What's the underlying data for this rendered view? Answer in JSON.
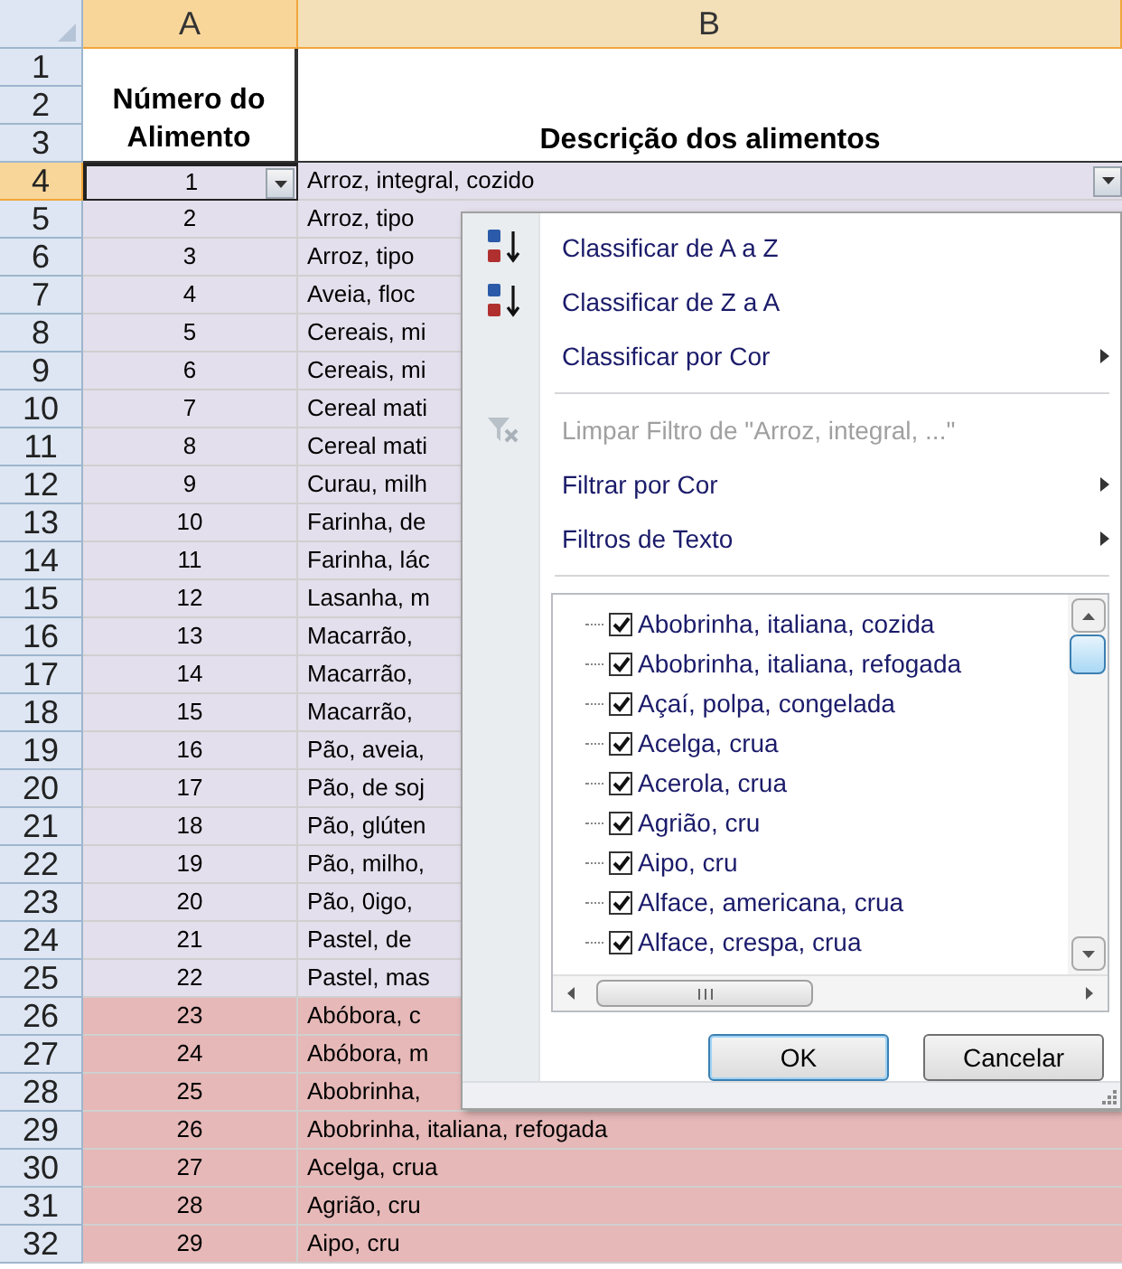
{
  "columns": [
    {
      "label": "A",
      "selected": true
    },
    {
      "label": "B",
      "selected": false
    }
  ],
  "row_numbers": [
    {
      "label": "1",
      "selected": false
    },
    {
      "label": "2",
      "selected": false
    },
    {
      "label": "3",
      "selected": false
    },
    {
      "label": "4",
      "selected": true
    },
    {
      "label": "5",
      "selected": false
    },
    {
      "label": "6",
      "selected": false
    },
    {
      "label": "7",
      "selected": false
    },
    {
      "label": "8",
      "selected": false
    },
    {
      "label": "9",
      "selected": false
    },
    {
      "label": "10",
      "selected": false
    },
    {
      "label": "11",
      "selected": false
    },
    {
      "label": "12",
      "selected": false
    },
    {
      "label": "13",
      "selected": false
    },
    {
      "label": "14",
      "selected": false
    },
    {
      "label": "15",
      "selected": false
    },
    {
      "label": "16",
      "selected": false
    },
    {
      "label": "17",
      "selected": false
    },
    {
      "label": "18",
      "selected": false
    },
    {
      "label": "19",
      "selected": false
    },
    {
      "label": "20",
      "selected": false
    },
    {
      "label": "21",
      "selected": false
    },
    {
      "label": "22",
      "selected": false
    },
    {
      "label": "23",
      "selected": false
    },
    {
      "label": "24",
      "selected": false
    },
    {
      "label": "25",
      "selected": false
    },
    {
      "label": "26",
      "selected": false
    },
    {
      "label": "27",
      "selected": false
    },
    {
      "label": "28",
      "selected": false
    },
    {
      "label": "29",
      "selected": false
    },
    {
      "label": "30",
      "selected": false
    },
    {
      "label": "31",
      "selected": false
    },
    {
      "label": "32",
      "selected": false
    }
  ],
  "header": {
    "number_title": [
      "Número do",
      "Alimento"
    ],
    "description_title": "Descrição dos alimentos"
  },
  "rows": [
    {
      "number": "1",
      "description": "Arroz, integral, cozido",
      "color": "#e4dfec",
      "filter_button": true
    },
    {
      "number": "2",
      "description": "Arroz, tipo",
      "color": "#e4dfec",
      "filter_button": false
    },
    {
      "number": "3",
      "description": "Arroz, tipo",
      "color": "#e4dfec",
      "filter_button": false
    },
    {
      "number": "4",
      "description": "Aveia, floc",
      "color": "#e4dfec",
      "filter_button": false
    },
    {
      "number": "5",
      "description": "Cereais, mi",
      "color": "#e4dfec",
      "filter_button": false
    },
    {
      "number": "6",
      "description": "Cereais, mi",
      "color": "#e4dfec",
      "filter_button": false
    },
    {
      "number": "7",
      "description": "Cereal mati",
      "color": "#e4dfec",
      "filter_button": false
    },
    {
      "number": "8",
      "description": "Cereal mati",
      "color": "#e4dfec",
      "filter_button": false
    },
    {
      "number": "9",
      "description": "Curau, milh",
      "color": "#e4dfec",
      "filter_button": false
    },
    {
      "number": "10",
      "description": "Farinha, de",
      "color": "#e4dfec",
      "filter_button": false
    },
    {
      "number": "11",
      "description": "Farinha, lác",
      "color": "#e4dfec",
      "filter_button": false
    },
    {
      "number": "12",
      "description": "Lasanha, m",
      "color": "#e4dfec",
      "filter_button": false
    },
    {
      "number": "13",
      "description": "Macarrão,",
      "color": "#e4dfec",
      "filter_button": false
    },
    {
      "number": "14",
      "description": "Macarrão,",
      "color": "#e4dfec",
      "filter_button": false
    },
    {
      "number": "15",
      "description": "Macarrão,",
      "color": "#e4dfec",
      "filter_button": false
    },
    {
      "number": "16",
      "description": "Pão, aveia,",
      "color": "#e4dfec",
      "filter_button": false
    },
    {
      "number": "17",
      "description": "Pão, de soj",
      "color": "#e4dfec",
      "filter_button": false
    },
    {
      "number": "18",
      "description": "Pão, glúten",
      "color": "#e4dfec",
      "filter_button": false
    },
    {
      "number": "19",
      "description": "Pão, milho,",
      "color": "#e4dfec",
      "filter_button": false
    },
    {
      "number": "20",
      "description": "Pão, 0igo,",
      "color": "#e4dfec",
      "filter_button": false
    },
    {
      "number": "21",
      "description": "Pastel, de",
      "color": "#e4dfec",
      "filter_button": false
    },
    {
      "number": "22",
      "description": "Pastel, mas",
      "color": "#e4dfec",
      "filter_button": false
    },
    {
      "number": "23",
      "description": "Abóbora, c",
      "color": "#e6b8b7",
      "filter_button": false
    },
    {
      "number": "24",
      "description": "Abóbora, m",
      "color": "#e6b8b7",
      "filter_button": false
    },
    {
      "number": "25",
      "description": "Abobrinha,",
      "color": "#e6b8b7",
      "filter_button": false
    },
    {
      "number": "26",
      "description": "Abobrinha, italiana, refogada",
      "color": "#e6b8b7",
      "filter_button": false
    },
    {
      "number": "27",
      "description": "Acelga, crua",
      "color": "#e6b8b7",
      "filter_button": false
    },
    {
      "number": "28",
      "description": "Agrião, cru",
      "color": "#e6b8b7",
      "filter_button": false
    },
    {
      "number": "29",
      "description": "Aipo, cru",
      "color": "#e6b8b7",
      "filter_button": false
    }
  ],
  "menu": {
    "items": [
      {
        "kind": "sort_az",
        "label": "Classificar de A a Z",
        "disabled": false,
        "submenu": false
      },
      {
        "kind": "sort_za",
        "label": "Classificar de Z a A",
        "disabled": false,
        "submenu": false
      },
      {
        "kind": "plain",
        "label": "Classificar por Cor",
        "disabled": false,
        "submenu": true
      },
      {
        "kind": "separator"
      },
      {
        "kind": "clear_filter",
        "label": "Limpar Filtro de \"Arroz, integral, ...\"",
        "disabled": true,
        "submenu": false
      },
      {
        "kind": "plain",
        "label": "Filtrar por Cor",
        "disabled": false,
        "submenu": true
      },
      {
        "kind": "plain",
        "label": "Filtros de Texto",
        "disabled": false,
        "submenu": true
      },
      {
        "kind": "separator"
      }
    ],
    "values": [
      {
        "label": "Abobrinha, italiana, cozida",
        "checked": true
      },
      {
        "label": "Abobrinha, italiana, refogada",
        "checked": true
      },
      {
        "label": "Açaí, polpa, congelada",
        "checked": true
      },
      {
        "label": "Acelga, crua",
        "checked": true
      },
      {
        "label": "Acerola, crua",
        "checked": true
      },
      {
        "label": "Agrião, cru",
        "checked": true
      },
      {
        "label": "Aipo, cru",
        "checked": true
      },
      {
        "label": "Alface, americana, crua",
        "checked": true
      },
      {
        "label": "Alface, crespa, crua",
        "checked": true
      }
    ],
    "buttons": [
      "OK",
      "Cancelar"
    ]
  }
}
